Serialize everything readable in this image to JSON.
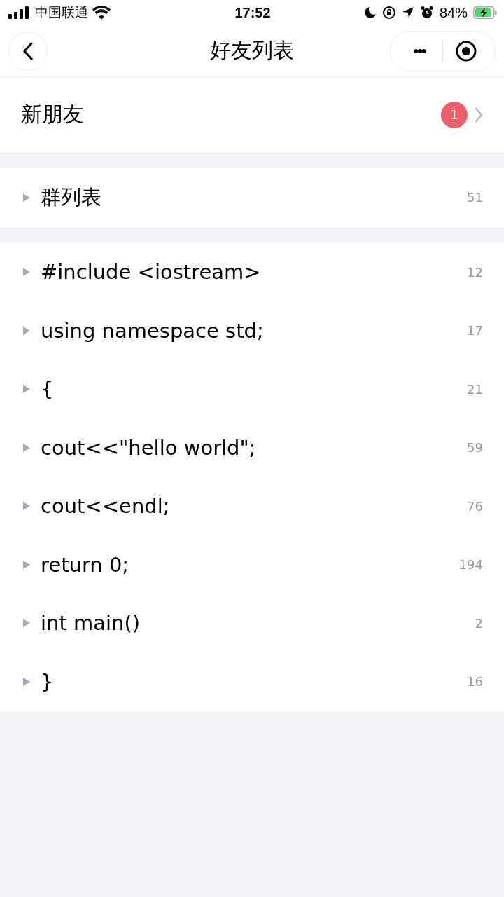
{
  "status_bar": {
    "carrier": "中国联通",
    "time": "17:52",
    "battery": "84%"
  },
  "nav": {
    "title": "好友列表",
    "more": "•••"
  },
  "new_friends": {
    "label": "新朋友",
    "badge": "1"
  },
  "sections": [
    {
      "groups": [
        {
          "label": "群列表",
          "count": "51",
          "expanded": false
        }
      ]
    },
    {
      "groups": [
        {
          "label": "#include <iostream>",
          "count": "12",
          "expanded": false
        },
        {
          "label": "using namespace std;",
          "count": "17",
          "expanded": false
        },
        {
          "label": "{",
          "count": "21",
          "expanded": false
        },
        {
          "label": "cout<<\"hello world\";",
          "count": "59",
          "expanded": false
        },
        {
          "label": "cout<<endl;",
          "count": "76",
          "expanded": false
        },
        {
          "label": "return 0;",
          "count": "194",
          "expanded": false
        },
        {
          "label": "int main()",
          "count": "2",
          "expanded": false
        },
        {
          "label": "}",
          "count": "16",
          "expanded": false
        }
      ]
    }
  ]
}
